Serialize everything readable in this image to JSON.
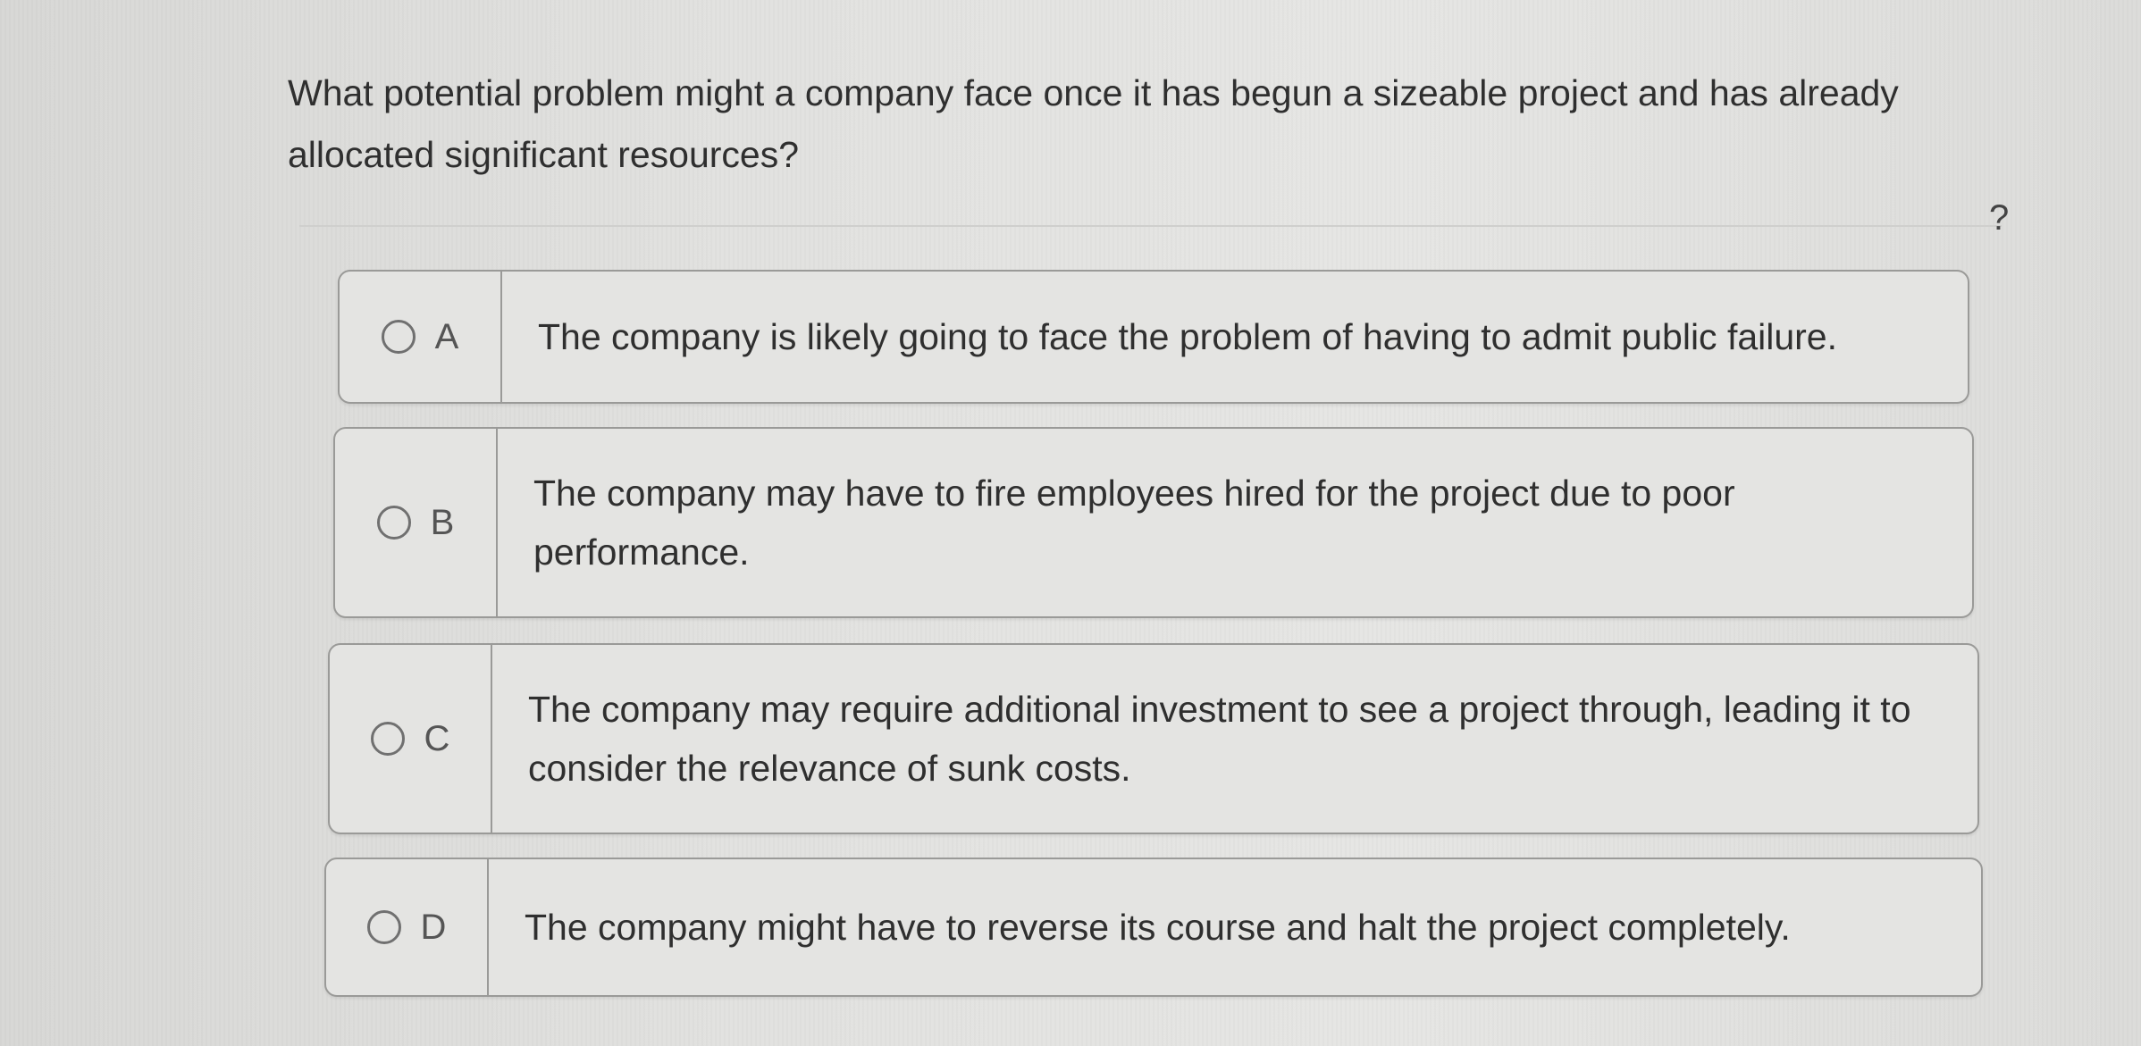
{
  "question": {
    "text": "What potential problem might a company face once it has begun a sizeable project and has already allocated significant resources?"
  },
  "help": {
    "label": "?"
  },
  "options": [
    {
      "letter": "A",
      "text": "The company is likely going to face the problem of having to admit public failure."
    },
    {
      "letter": "B",
      "text": "The company may have to fire employees hired for the project due to poor performance."
    },
    {
      "letter": "C",
      "text": "The company may require additional investment to see a project through, leading it to consider the relevance of sunk costs."
    },
    {
      "letter": "D",
      "text": "The company might have to reverse its course and halt the project completely."
    }
  ]
}
